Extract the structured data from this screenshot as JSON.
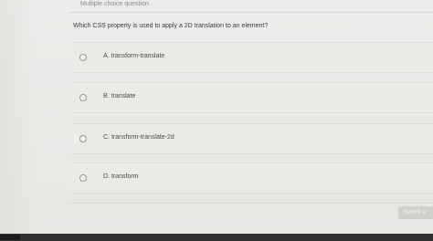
{
  "header": {
    "quiz_type": "Multiple choice question"
  },
  "question": {
    "text": "Which CSS property is used to apply a 2D translation to an element?"
  },
  "options": [
    {
      "letter": "A.",
      "text": "transform-translate",
      "label": "A.  transform-translate"
    },
    {
      "letter": "B.",
      "text": "translate",
      "label": "B.  translate"
    },
    {
      "letter": "C.",
      "text": "transform-translate-2d",
      "label": "C.  transform-translate-2d"
    },
    {
      "letter": "D.",
      "text": "transform",
      "label": "D.  transform"
    }
  ],
  "footer": {
    "submit_label": "Submit a"
  },
  "icons": {
    "cursor": "hand-pointer-icon",
    "radio": "radio-circle-icon"
  },
  "colors": {
    "background": "#e9e9e6",
    "submit_button": "#d0d0cd"
  }
}
